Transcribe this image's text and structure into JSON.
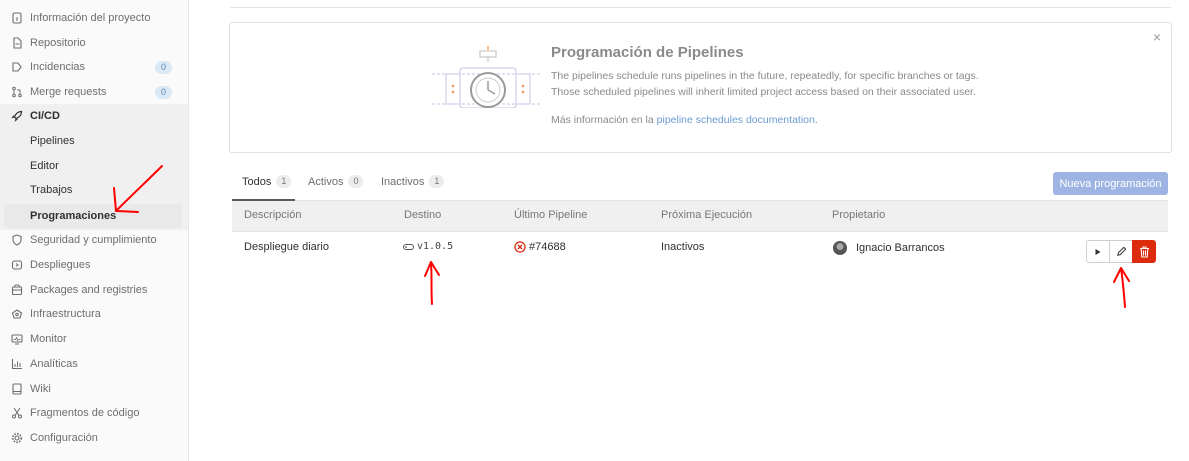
{
  "sidebar": {
    "items": [
      {
        "label": "Información del proyecto",
        "icon": "info-icon"
      },
      {
        "label": "Repositorio",
        "icon": "file-icon"
      },
      {
        "label": "Incidencias",
        "icon": "issues-icon",
        "badge": "0"
      },
      {
        "label": "Merge requests",
        "icon": "merge-request-icon",
        "badge": "0"
      },
      {
        "label": "CI/CD",
        "icon": "rocket-icon"
      },
      {
        "label": "Seguridad y cumplimiento",
        "icon": "shield-icon"
      },
      {
        "label": "Despliegues",
        "icon": "deployments-icon"
      },
      {
        "label": "Packages and registries",
        "icon": "package-icon"
      },
      {
        "label": "Infraestructura",
        "icon": "cloud-icon"
      },
      {
        "label": "Monitor",
        "icon": "monitor-icon"
      },
      {
        "label": "Analíticas",
        "icon": "chart-icon"
      },
      {
        "label": "Wiki",
        "icon": "book-icon"
      },
      {
        "label": "Fragmentos de código",
        "icon": "scissors-icon"
      },
      {
        "label": "Configuración",
        "icon": "gear-icon"
      }
    ],
    "cicd_sub": [
      "Pipelines",
      "Editor",
      "Trabajos",
      "Programaciones"
    ]
  },
  "banner": {
    "title": "Programación de Pipelines",
    "line1": "The pipelines schedule runs pipelines in the future, repeatedly, for specific branches or tags.",
    "line2": "Those scheduled pipelines will inherit limited project access based on their associated user.",
    "more_prefix": "Más información en la ",
    "more_link": "pipeline schedules documentation",
    "more_suffix": ".",
    "close": "×"
  },
  "tabs": [
    {
      "label": "Todos",
      "count": "1"
    },
    {
      "label": "Activos",
      "count": "0"
    },
    {
      "label": "Inactivos",
      "count": "1"
    }
  ],
  "new_button": "Nueva programación",
  "table": {
    "headers": [
      "Descripción",
      "Destino",
      "Último Pipeline",
      "Próxima Ejecución",
      "Propietario"
    ],
    "rows": [
      {
        "description": "Despliegue diario",
        "target": "v1.0.5",
        "pipeline": "#74688",
        "next_run": "Inactivos",
        "owner": "Ignacio Barrancos"
      }
    ]
  },
  "colors": {
    "accent": "#9eb5e3",
    "danger": "#dd2b0e",
    "annotation": "#ff0000"
  }
}
